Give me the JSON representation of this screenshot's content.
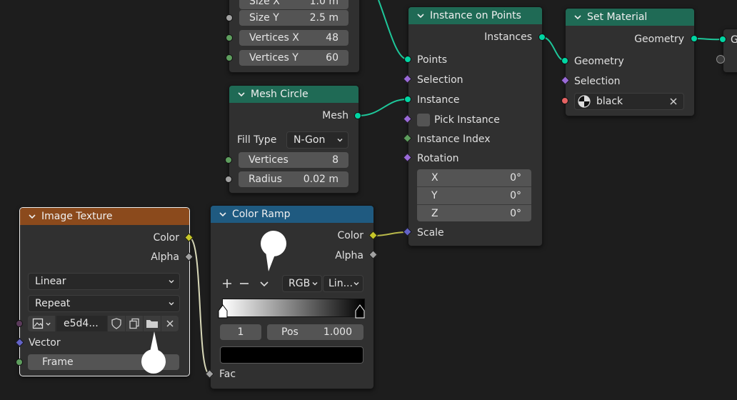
{
  "grid_node": {
    "size_x": {
      "label": "Size X",
      "value": "1.0 m"
    },
    "size_y": {
      "label": "Size Y",
      "value": "2.5 m"
    },
    "vertices_x": {
      "label": "Vertices X",
      "value": "48"
    },
    "vertices_y": {
      "label": "Vertices Y",
      "value": "60"
    }
  },
  "mesh_circle": {
    "title": "Mesh Circle",
    "output_mesh": "Mesh",
    "fill_type_label": "Fill Type",
    "fill_type_value": "N-Gon",
    "vertices": {
      "label": "Vertices",
      "value": "8"
    },
    "radius": {
      "label": "Radius",
      "value": "0.02 m"
    }
  },
  "instance_on_points": {
    "title": "Instance on Points",
    "output_instances": "Instances",
    "points": "Points",
    "selection": "Selection",
    "instance": "Instance",
    "pick_instance": "Pick Instance",
    "instance_index": "Instance Index",
    "rotation": "Rotation",
    "rot_x": {
      "label": "X",
      "value": "0°"
    },
    "rot_y": {
      "label": "Y",
      "value": "0°"
    },
    "rot_z": {
      "label": "Z",
      "value": "0°"
    },
    "scale": "Scale"
  },
  "set_material": {
    "title": "Set Material",
    "output_geometry": "Geometry",
    "geometry": "Geometry",
    "selection": "Selection",
    "material": "black"
  },
  "next_node": {
    "output_initial": "G"
  },
  "image_texture": {
    "title": "Image Texture",
    "output_color": "Color",
    "output_alpha": "Alpha",
    "interpolation": "Linear",
    "extension": "Repeat",
    "image_name": "e5d4...",
    "vector": "Vector",
    "frame": "Frame"
  },
  "color_ramp": {
    "title": "Color Ramp",
    "output_color": "Color",
    "output_alpha": "Alpha",
    "color_mode": "RGB",
    "interpolation": "Lin...",
    "stop_index": "1",
    "pos_label": "Pos",
    "pos_value": "1.000",
    "fac": "Fac",
    "active_color": "#000000"
  },
  "colors": {
    "geometry_header": "#1f6a55",
    "texture_header": "#8b4a1c",
    "converter_header": "#1f5a80",
    "geometry_link": "#00d6a3",
    "color_link": "#c7c729"
  }
}
